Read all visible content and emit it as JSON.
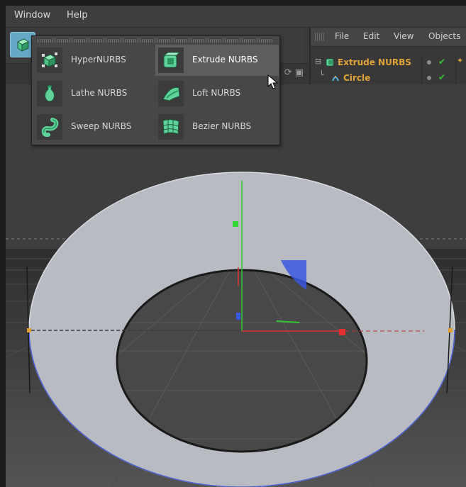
{
  "menubar": {
    "items": [
      "Window",
      "Help"
    ]
  },
  "nurbs_popup": {
    "items": [
      {
        "label": "HyperNURBS",
        "icon": "hypernurbs-icon"
      },
      {
        "label": "Extrude NURBS",
        "icon": "extrude-nurbs-icon",
        "selected": true
      },
      {
        "label": "Lathe NURBS",
        "icon": "lathe-nurbs-icon"
      },
      {
        "label": "Loft NURBS",
        "icon": "loft-nurbs-icon"
      },
      {
        "label": "Sweep NURBS",
        "icon": "sweep-nurbs-icon"
      },
      {
        "label": "Bezier NURBS",
        "icon": "bezier-nurbs-icon"
      }
    ]
  },
  "object_manager": {
    "menu": [
      "File",
      "Edit",
      "View",
      "Objects"
    ],
    "objects": [
      {
        "name": "Extrude NURBS",
        "icon": "extrude-nurbs-icon"
      },
      {
        "name": "Circle",
        "icon": "circle-spline-icon"
      }
    ]
  },
  "colors": {
    "accent_blue": "#66a9c7",
    "object_name": "#e2a33a",
    "nurbs_icon_green": "#5fd39a",
    "axis_x": "#e03232",
    "axis_y": "#33c733",
    "axis_z": "#3a58e0"
  }
}
